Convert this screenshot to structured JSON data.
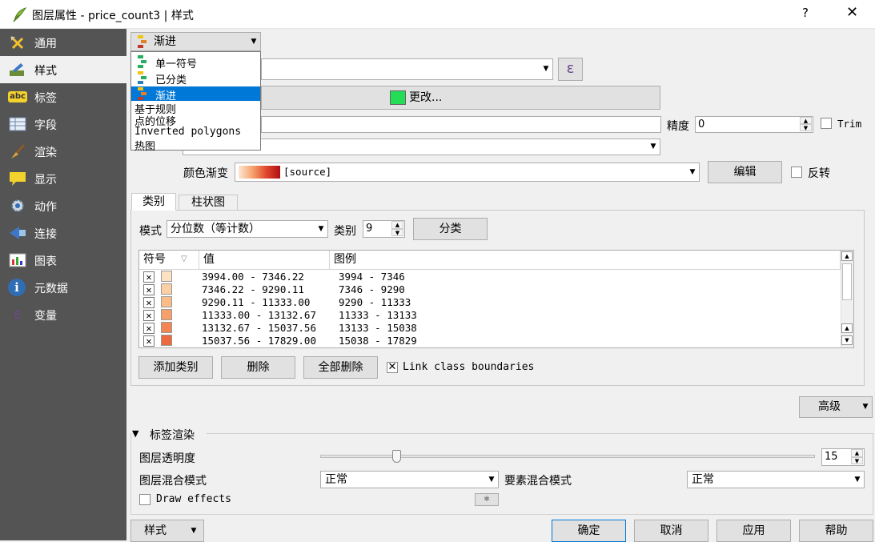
{
  "window": {
    "title": "图层属性 - price_count3 | 样式",
    "help_label": "?",
    "close_label": "✕"
  },
  "sidebar": {
    "items": [
      {
        "label": "通用",
        "icon": "tools-icon"
      },
      {
        "label": "样式",
        "icon": "paintbrush-icon"
      },
      {
        "label": "标签",
        "icon": "label-abc-icon",
        "icon_text": "abc"
      },
      {
        "label": "字段",
        "icon": "table-icon"
      },
      {
        "label": "渲染",
        "icon": "brush-icon"
      },
      {
        "label": "显示",
        "icon": "speech-bubble-icon"
      },
      {
        "label": "动作",
        "icon": "gear-icon"
      },
      {
        "label": "连接",
        "icon": "join-icon"
      },
      {
        "label": "图表",
        "icon": "chart-icon"
      },
      {
        "label": "元数据",
        "icon": "info-icon",
        "icon_text": "i"
      },
      {
        "label": "变量",
        "icon": "epsilon-icon",
        "icon_text": "ε"
      }
    ],
    "selected": "样式"
  },
  "renderer": {
    "selected": "渐进",
    "options": [
      {
        "label": "单一符号",
        "icon": true
      },
      {
        "label": "已分类",
        "icon": true
      },
      {
        "label": "渐进",
        "icon": true
      },
      {
        "label": "基于规则",
        "icon": false
      },
      {
        "label": "点的位移",
        "icon": false
      },
      {
        "label": "Inverted polygons",
        "icon": false
      },
      {
        "label": "热图",
        "icon": false
      }
    ]
  },
  "expression_button": "ε",
  "symbol": {
    "change_label": "更改...",
    "swatch_color": "#22dd55"
  },
  "precision": {
    "label": "精度",
    "value": "0",
    "trim_label": "Trim"
  },
  "ramp": {
    "label": "颜色渐变",
    "value": "[source]",
    "edit_label": "编辑",
    "invert_label": "反转"
  },
  "tabs": {
    "classes": "类别",
    "histogram": "柱状图"
  },
  "mode": {
    "label": "模式",
    "value": "分位数（等计数）",
    "classes_label": "类别",
    "classes_value": "9",
    "classify_button": "分类"
  },
  "table": {
    "headers": [
      "符号",
      "值",
      "图例"
    ],
    "rows": [
      {
        "value": "3994.00 - 7346.22",
        "legend": "3994 - 7346",
        "color": "#fde1c3"
      },
      {
        "value": "7346.22 - 9290.11",
        "legend": "7346 - 9290",
        "color": "#fcd0a4"
      },
      {
        "value": "9290.11 - 11333.00",
        "legend": "9290 - 11333",
        "color": "#fbbd88"
      },
      {
        "value": "11333.00 - 13132.67",
        "legend": "11333 - 13133",
        "color": "#f8a06c"
      },
      {
        "value": "13132.67 - 15037.56",
        "legend": "13133 - 15038",
        "color": "#f38552"
      },
      {
        "value": "15037.56 - 17829.00",
        "legend": "15038 - 17829",
        "color": "#ec6a3e"
      }
    ]
  },
  "actions": {
    "add": "添加类别",
    "delete": "删除",
    "delete_all": "全部删除",
    "link_label": "Link class boundaries"
  },
  "advanced_label": "高级",
  "layer_rendering": {
    "title": "标签渲染",
    "transparency_label": "图层透明度",
    "transparency_value": "15",
    "transparency_level": 15,
    "blend_label": "图层混合模式",
    "blend_value": "正常",
    "feature_blend_label": "要素混合模式",
    "feature_blend_value": "正常",
    "draw_effects_label": "Draw effects"
  },
  "footer": {
    "style": "样式",
    "ok": "确定",
    "cancel": "取消",
    "apply": "应用",
    "help": "帮助"
  }
}
